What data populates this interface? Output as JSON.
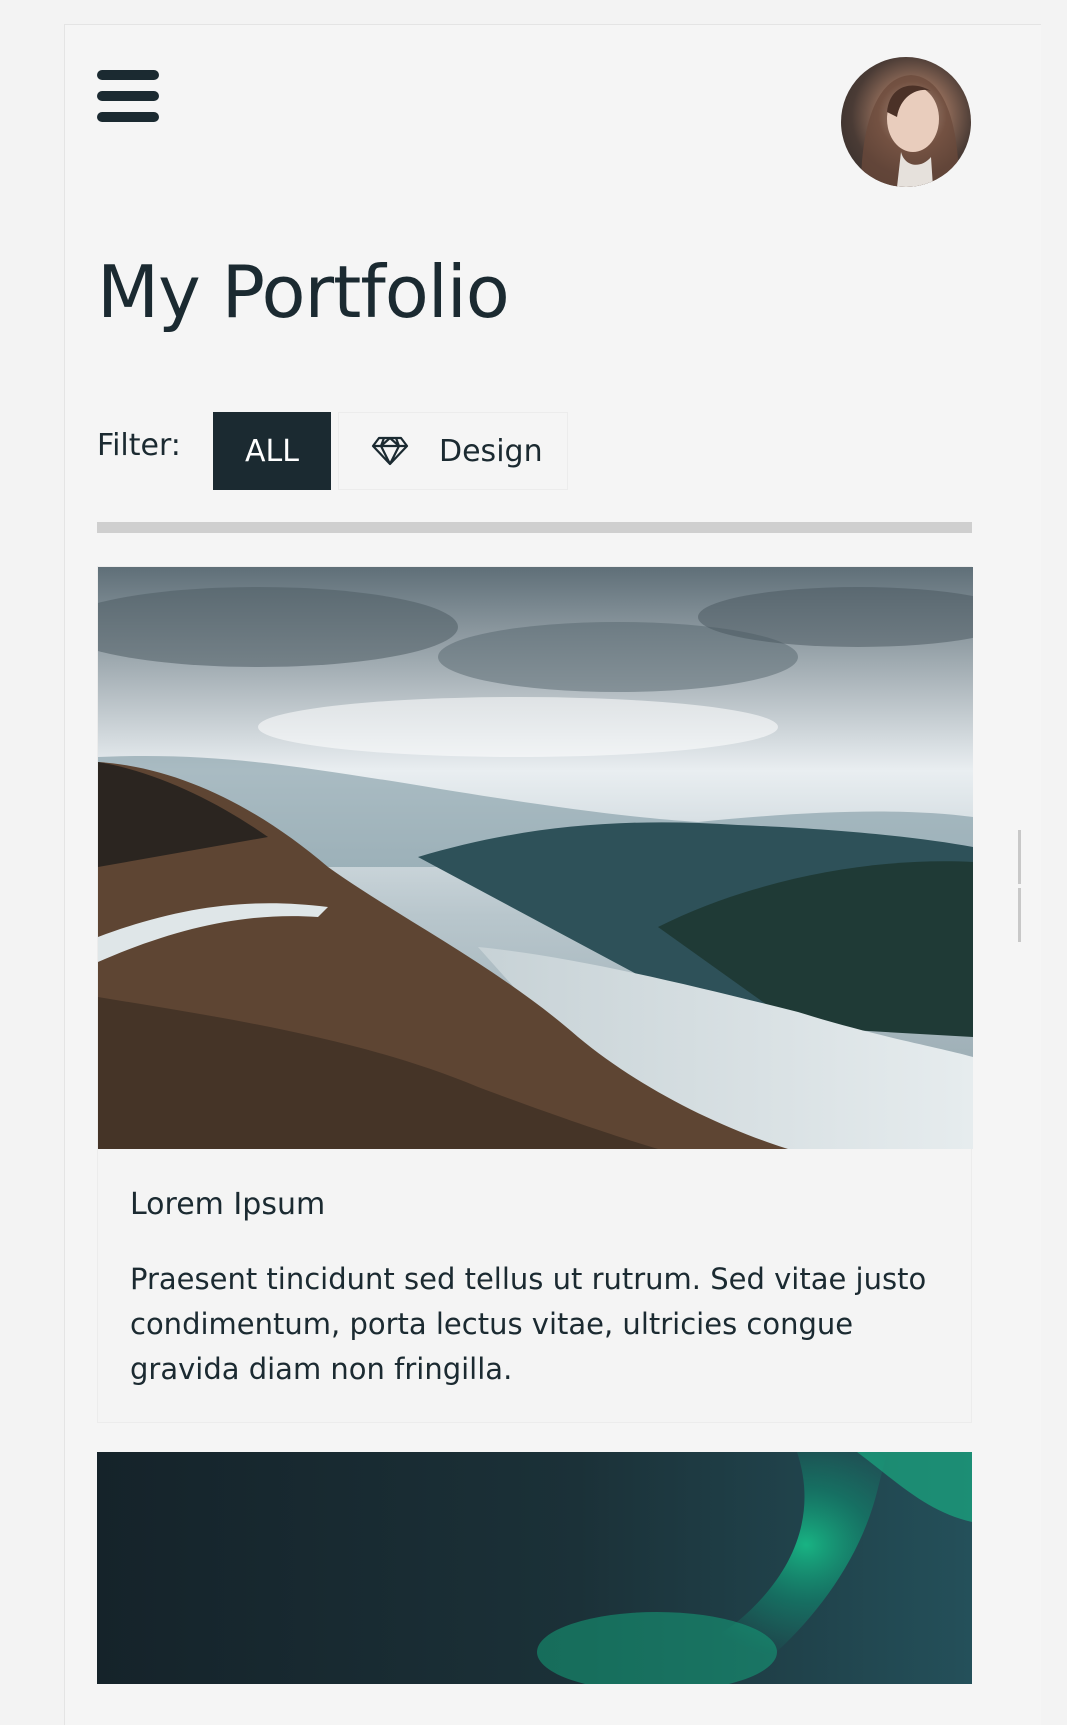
{
  "header": {
    "menu_icon": "hamburger-menu-icon",
    "avatar_icon": "user-avatar"
  },
  "page": {
    "title": "My Portfolio"
  },
  "filter": {
    "label": "Filter:",
    "options": [
      {
        "label": "ALL",
        "active": true
      },
      {
        "label": "Design",
        "icon": "diamond-icon",
        "active": false
      }
    ]
  },
  "cards": [
    {
      "image": "mountain-landscape-image",
      "title": "Lorem Ipsum",
      "description": "Praesent tincidunt sed tellus ut rutrum. Sed vitae justo condimentum, porta lectus vitae, ultricies congue gravida diam non fringilla."
    },
    {
      "image": "aurora-night-sky-image"
    }
  ],
  "colors": {
    "primary": "#1b2a31",
    "background": "#f5f5f5",
    "divider": "#cfcfcf"
  }
}
